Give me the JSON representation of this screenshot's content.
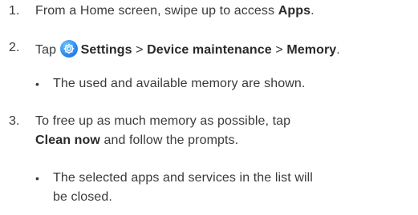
{
  "steps": [
    {
      "number": "1.",
      "parts": [
        "From a Home screen, swipe up to access ",
        "Apps",
        "."
      ]
    },
    {
      "number": "2.",
      "parts": [
        "Tap ",
        "Settings",
        " > ",
        "Device maintenance",
        " > ",
        "Memory",
        "."
      ],
      "icon": "settings-gear-icon"
    },
    {
      "bullet": "•",
      "text": "The used and available memory are shown."
    },
    {
      "number": "3.",
      "line1": "To free up as much memory as possible, tap",
      "line2_parts": [
        "Clean now",
        " and follow the prompts."
      ]
    },
    {
      "bullet": "•",
      "line1": "The selected apps and services in the list will",
      "line2": "be closed."
    }
  ],
  "colors": {
    "text": "#3a3a3a",
    "settings_icon": "#2f8cf0"
  }
}
